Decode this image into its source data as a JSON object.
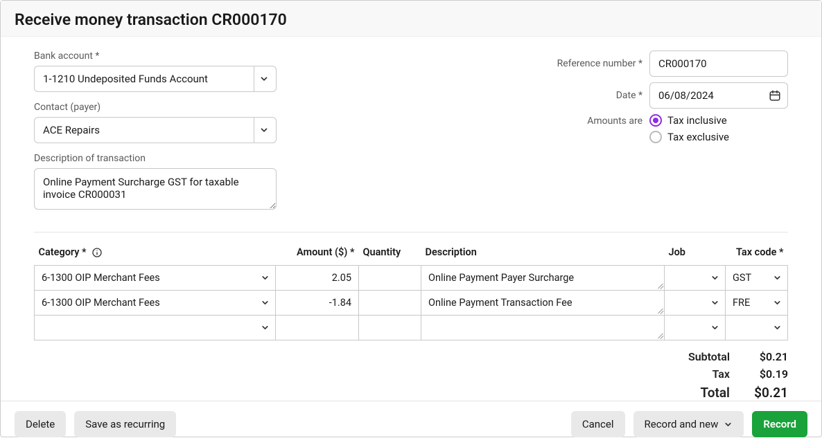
{
  "page_title": "Receive money transaction CR000170",
  "left": {
    "bank_label": "Bank account *",
    "bank_value": "1-1210  Undeposited Funds Account",
    "contact_label": "Contact (payer)",
    "contact_value": "ACE Repairs",
    "desc_label": "Description of transaction",
    "desc_value": "Online Payment Surcharge GST for taxable invoice CR000031"
  },
  "right": {
    "ref_label": "Reference number *",
    "ref_value": "CR000170",
    "date_label": "Date *",
    "date_value": "06/08/2024",
    "amounts_label": "Amounts are",
    "radio_inclusive": "Tax inclusive",
    "radio_exclusive": "Tax exclusive"
  },
  "table": {
    "headers": {
      "category": "Category *",
      "amount": "Amount ($) *",
      "quantity": "Quantity",
      "description": "Description",
      "job": "Job",
      "taxcode": "Tax code *"
    },
    "rows": [
      {
        "category": "6-1300  OIP Merchant Fees",
        "amount": "2.05",
        "quantity": "",
        "description": "Online Payment Payer Surcharge",
        "job": "",
        "taxcode": "GST"
      },
      {
        "category": "6-1300  OIP Merchant Fees",
        "amount": "-1.84",
        "quantity": "",
        "description": "Online Payment Transaction Fee",
        "job": "",
        "taxcode": "FRE"
      },
      {
        "category": "",
        "amount": "",
        "quantity": "",
        "description": "",
        "job": "",
        "taxcode": ""
      }
    ]
  },
  "totals": {
    "subtotal_label": "Subtotal",
    "subtotal_value": "$0.21",
    "tax_label": "Tax",
    "tax_value": "$0.19",
    "total_label": "Total",
    "total_value": "$0.21"
  },
  "footer": {
    "delete": "Delete",
    "save_recurring": "Save as recurring",
    "cancel": "Cancel",
    "record_new": "Record and new",
    "record": "Record"
  }
}
